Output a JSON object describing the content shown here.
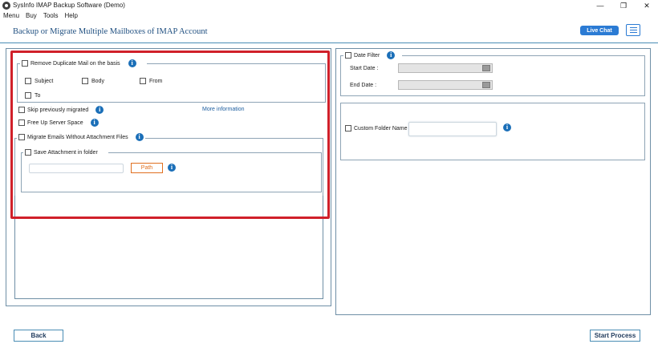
{
  "window": {
    "title": "SysInfo IMAP Backup Software (Demo)",
    "minimize_glyph": "—",
    "maximize_glyph": "❐",
    "close_glyph": "✕"
  },
  "menu": [
    "Menu",
    "Buy",
    "Tools",
    "Help"
  ],
  "header": {
    "title": "Backup or Migrate Multiple Mailboxes of IMAP Account",
    "live_chat": "Live Chat"
  },
  "left_panel": {
    "remove_duplicate": {
      "label": "Remove Duplicate Mail on the basis",
      "options": [
        "Subject",
        "Body",
        "From",
        "To"
      ]
    },
    "skip_migrated": "Skip previously migrated",
    "more_information": "More information",
    "free_up_space": "Free Up Server Space",
    "migrate_without_attachments": "Migrate Emails Without Attachment Files",
    "save_attachment": "Save Attachment in folder",
    "path_button": "Path"
  },
  "right_panel": {
    "date_filter": "Date Filter",
    "start_date_label": "Start Date :",
    "end_date_label": "End Date :",
    "custom_folder_label": "Custom Folder Name"
  },
  "footer": {
    "back": "Back",
    "start_process": "Start Process"
  },
  "info_glyph": "i",
  "colors": {
    "accent": "#2b7bd4",
    "highlight_border": "#d0202a",
    "path_button": "#e07020",
    "title_text": "#1f4f80"
  }
}
